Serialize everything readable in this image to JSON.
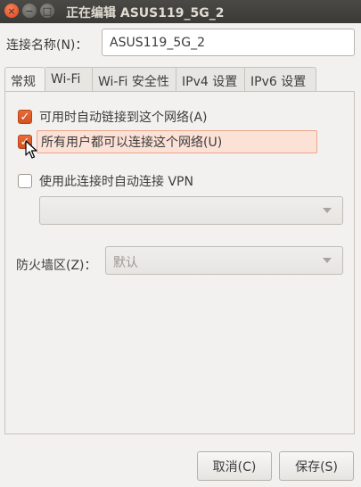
{
  "window": {
    "title": "正在编辑 ASUS119_5G_2",
    "close_glyph": "×",
    "minimize_glyph": "−",
    "maximize_glyph": "□"
  },
  "connection": {
    "label": "连接名称(N)：",
    "value": "ASUS119_5G_2"
  },
  "tabs": [
    {
      "label": "常规",
      "active": true
    },
    {
      "label": "Wi-Fi",
      "active": false
    },
    {
      "label": "Wi-Fi 安全性",
      "active": false
    },
    {
      "label": "IPv4 设置",
      "active": false
    },
    {
      "label": "IPv6 设置",
      "active": false
    }
  ],
  "general": {
    "auto_connect": {
      "label": "可用时自动链接到这个网络(A)",
      "checked": true,
      "check_glyph": "✓"
    },
    "all_users": {
      "label": "所有用户都可以连接这个网络(U)",
      "checked": true,
      "check_glyph": "✓"
    },
    "auto_vpn": {
      "label": "使用此连接时自动连接 VPN",
      "checked": false
    },
    "vpn_select": {
      "value": ""
    },
    "firewall": {
      "label": "防火墙区(Z)：",
      "value": "默认"
    }
  },
  "buttons": {
    "cancel": "取消(C)",
    "save": "保存(S)"
  },
  "colors": {
    "accent": "#dd5a2a",
    "highlight_bg": "#fbe1d6",
    "titlebar": "#3c3b37"
  }
}
